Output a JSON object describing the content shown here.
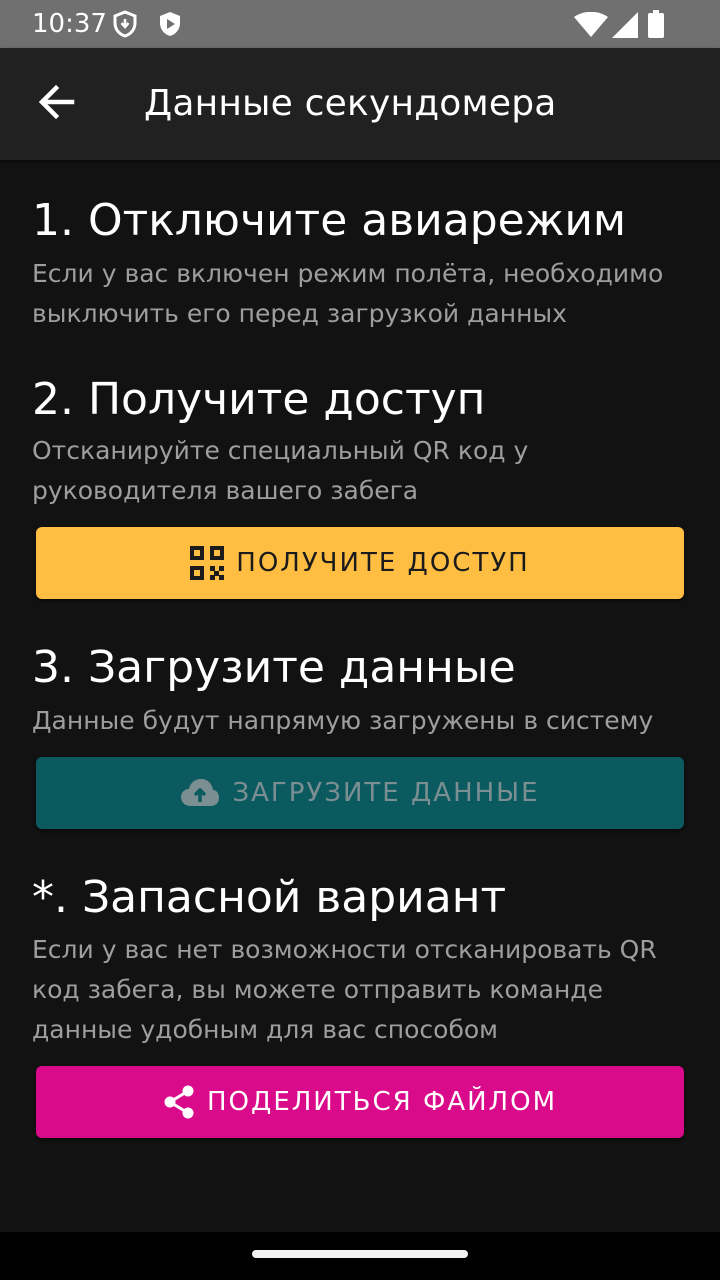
{
  "status_bar": {
    "time": "10:37",
    "icons": [
      "shield-outline-icon",
      "shield-play-icon",
      "wifi-icon",
      "signal-icon",
      "battery-icon"
    ]
  },
  "app_bar": {
    "back_icon": "arrow-left-icon",
    "title": "Данные секундомера"
  },
  "sections": [
    {
      "title": "1. Отключите авиарежим",
      "description": "Если у вас включен режим полёта, необходимо выключить его перед загрузкой данных"
    },
    {
      "title": "2. Получите доступ",
      "description": "Отсканируйте специальный QR код у руководителя вашего забега",
      "button": {
        "label": "ПОЛУЧИТЕ ДОСТУП",
        "icon": "qr-code-icon",
        "color": "#FFBE42"
      }
    },
    {
      "title": "3. Загрузите данные",
      "description": "Данные будут напрямую загружены в систему",
      "button": {
        "label": "ЗАГРУЗИТЕ ДАННЫЕ",
        "icon": "cloud-upload-icon",
        "color": "#0A5A60",
        "disabled": true
      }
    },
    {
      "title": "*. Запасной вариант",
      "description": "Если у вас нет возможности отсканировать QR код забега, вы можете отправить команде данные удобным для вас способом",
      "button": {
        "label": "ПОДЕЛИТЬСЯ ФАЙЛОМ",
        "icon": "share-icon",
        "color": "#D90B8A"
      }
    }
  ]
}
